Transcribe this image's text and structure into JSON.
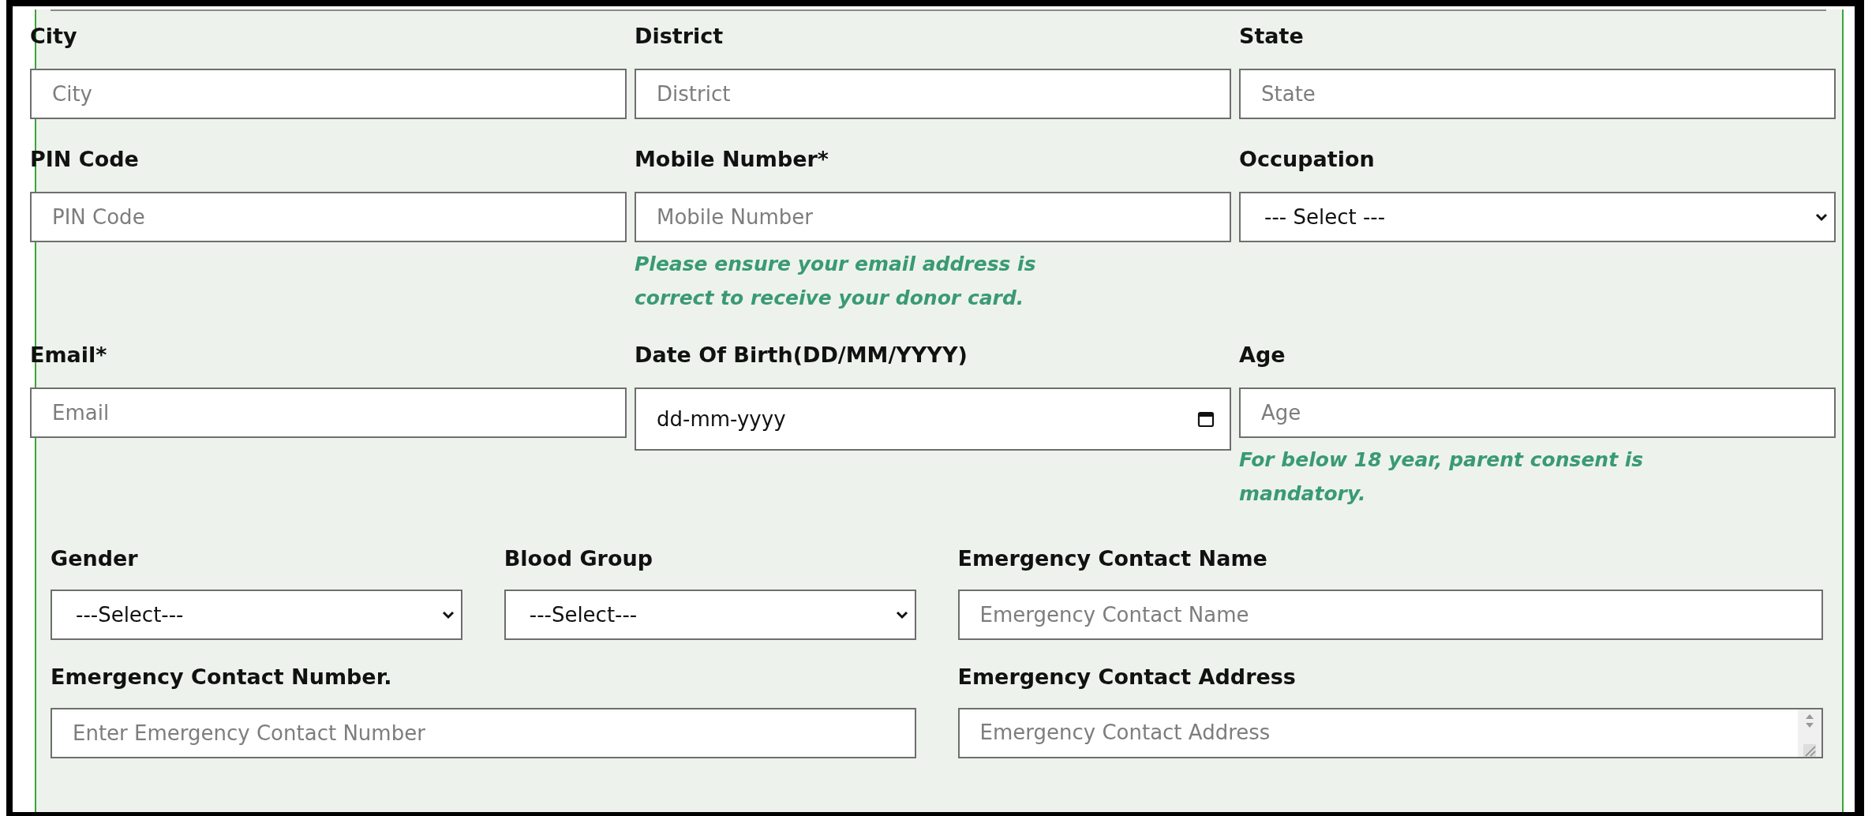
{
  "main_fields": [
    {
      "label": "City",
      "kind": "text",
      "placeholder": "City"
    },
    {
      "label": "District",
      "kind": "text",
      "placeholder": "District"
    },
    {
      "label": "State",
      "kind": "text",
      "placeholder": "State"
    },
    {
      "label": "PIN Code",
      "kind": "text",
      "placeholder": "PIN Code"
    },
    {
      "label": "Mobile Number*",
      "kind": "text",
      "placeholder": "Mobile Number",
      "note": "Please ensure your email address is correct to receive your donor card."
    },
    {
      "label": "Occupation",
      "kind": "select",
      "value": "--- Select ---"
    },
    {
      "label": "Email*",
      "kind": "text",
      "placeholder": "Email"
    },
    {
      "label": "Date Of Birth(DD/MM/YYYY)",
      "kind": "date",
      "value": "dd-mm-yyyy"
    },
    {
      "label": "Age",
      "kind": "text",
      "placeholder": "Age",
      "note": "For below 18 year, parent consent is mandatory."
    }
  ],
  "extra_fields": [
    {
      "label": "Gender",
      "kind": "select",
      "value": "---Select---"
    },
    {
      "label": "Blood Group",
      "kind": "select",
      "value": "---Select---"
    },
    {
      "label": "Emergency Contact Name",
      "kind": "text",
      "placeholder": "Emergency Contact Name"
    },
    {
      "label": "Emergency Contact Number.",
      "kind": "text",
      "placeholder": "Enter Emergency Contact Number"
    },
    {
      "label": "Emergency Contact Address",
      "kind": "textarea",
      "placeholder": "Emergency Contact Address"
    }
  ]
}
